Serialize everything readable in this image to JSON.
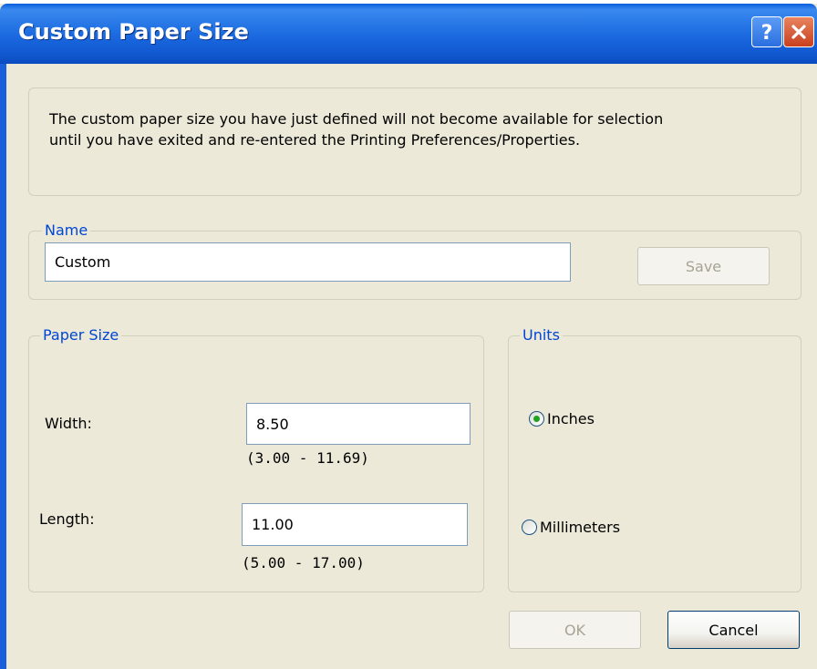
{
  "window": {
    "title": "Custom Paper Size"
  },
  "message": {
    "line1": "The custom paper size you have just defined will not become available for selection",
    "line2": "until you have exited and re-entered the Printing Preferences/Properties."
  },
  "name_group": {
    "legend": "Name",
    "value": "Custom",
    "save_label": "Save"
  },
  "paper_size": {
    "legend": "Paper Size",
    "width_label": "Width:",
    "width_value": "8.50",
    "width_range": "(3.00 - 11.69)",
    "length_label": "Length:",
    "length_value": "11.00",
    "length_range": "(5.00 - 17.00)"
  },
  "units": {
    "legend": "Units",
    "options": [
      {
        "label": "Inches",
        "selected": true
      },
      {
        "label": "Millimeters",
        "selected": false
      }
    ]
  },
  "buttons": {
    "ok": "OK",
    "cancel": "Cancel"
  },
  "colors": {
    "titlebar": "#2a7ae8",
    "dialog_bg": "#ece9d8",
    "legend_text": "#0046d5",
    "close_button": "#c8401e"
  }
}
